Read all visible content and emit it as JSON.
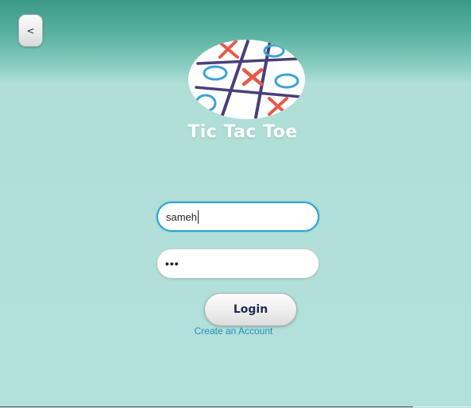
{
  "header": {
    "back_label": "<"
  },
  "brand": {
    "title": "Tic Tac Toe",
    "logo_icon": "tic-tac-toe-board-icon"
  },
  "form": {
    "username_value": "sameh",
    "password_value": "•••",
    "login_label": "Login",
    "create_account_label": "Create an Account"
  },
  "colors": {
    "background": "#b2e0da",
    "header_gradient_top": "#3a9a86",
    "focus_border": "#2ba3d6",
    "link": "#1f8fc4",
    "x_mark": "#e8584a",
    "o_mark": "#3aa3d6",
    "grid_lines": "#4a3f78"
  }
}
